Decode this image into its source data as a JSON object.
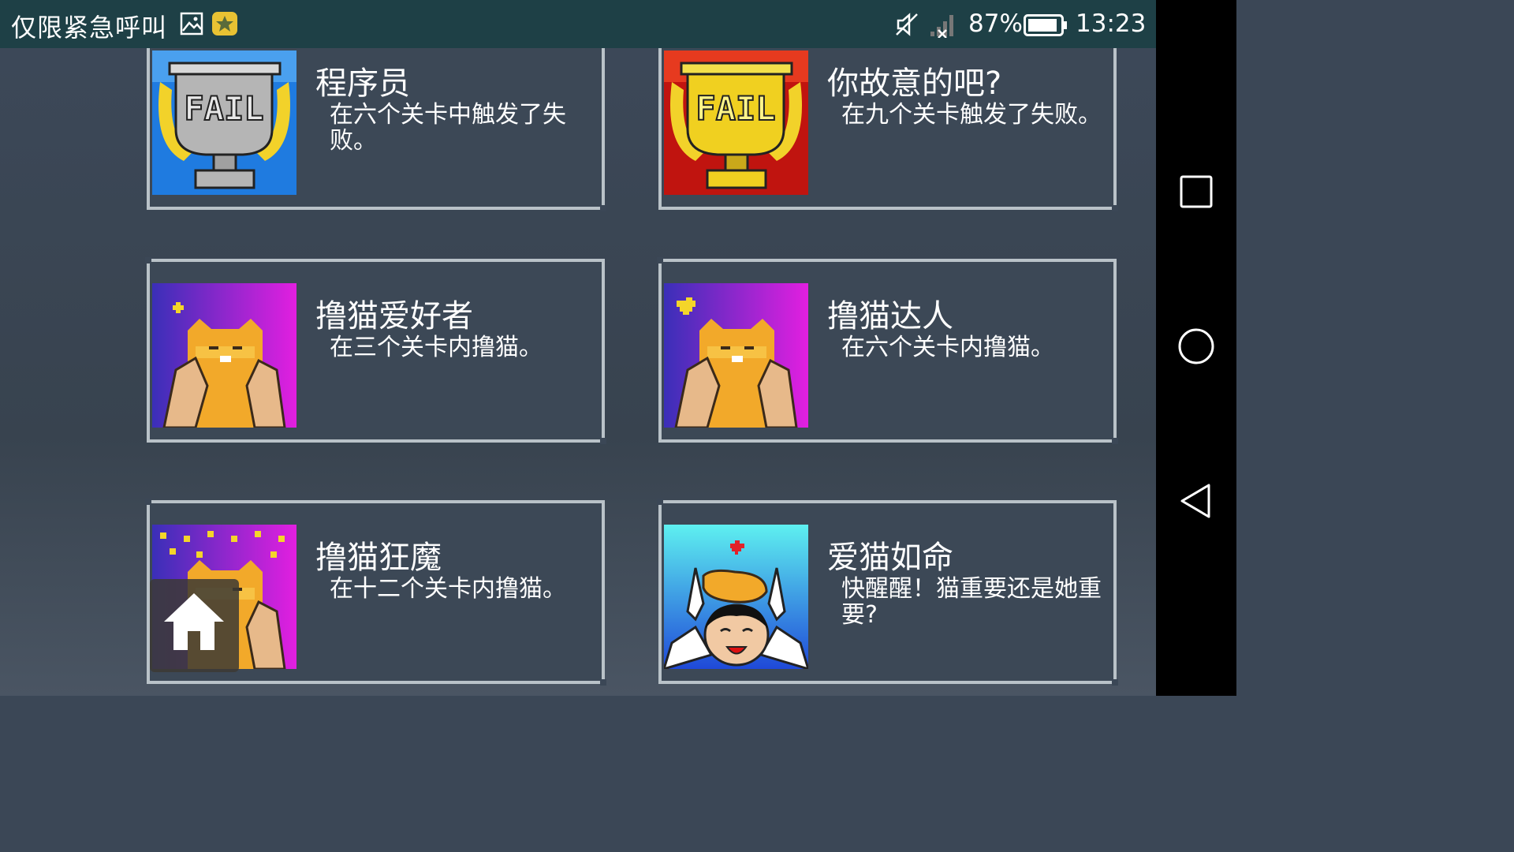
{
  "status_bar": {
    "carrier": "仅限紧急呼叫",
    "battery_percent": "87%",
    "time": "13:23",
    "icons": [
      "image-icon",
      "star-badge-icon",
      "mute-icon",
      "no-signal-icon",
      "battery-icon"
    ]
  },
  "achievements": [
    {
      "title": "程序员",
      "description": "在六个关卡中触发了失败。",
      "icon": "silver-fail-trophy-icon",
      "thumb_text": "FAIL"
    },
    {
      "title": "你故意的吧?",
      "description": "在九个关卡触发了失败。",
      "icon": "gold-fail-trophy-icon",
      "thumb_text": "FAIL"
    },
    {
      "title": "撸猫爱好者",
      "description": "在三个关卡内撸猫。",
      "icon": "cat-petting-icon"
    },
    {
      "title": "撸猫达人",
      "description": "在六个关卡内撸猫。",
      "icon": "cat-petting-big-heart-icon"
    },
    {
      "title": "撸猫狂魔",
      "description": "在十二个关卡内撸猫。",
      "icon": "cat-petting-many-hearts-icon"
    },
    {
      "title": "爱猫如命",
      "description": "快醒醒！猫重要还是她重要?",
      "icon": "cat-on-head-icon"
    }
  ],
  "floating_button": {
    "icon": "home-icon"
  },
  "nav_bar": {
    "icons": [
      "recents-square-icon",
      "home-circle-icon",
      "back-triangle-icon"
    ]
  },
  "colors": {
    "status_bar_bg": "#1e4046",
    "card_border": "#b9c2c8",
    "background": "#3b4756"
  }
}
